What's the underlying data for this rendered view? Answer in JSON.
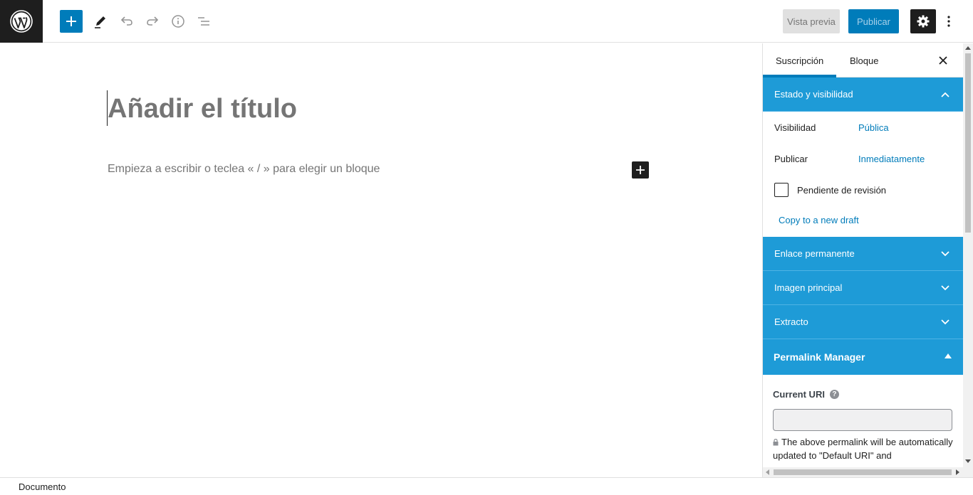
{
  "toolbar": {
    "logo_icon": "wordpress-icon",
    "add_block_icon": "plus-icon",
    "tools_icon": "pencil-icon",
    "undo_icon": "undo-icon",
    "redo_icon": "redo-icon",
    "details_icon": "info-icon",
    "outline_icon": "list-view-icon",
    "preview_label": "Vista previa",
    "publish_label": "Publicar",
    "settings_icon": "gear-icon",
    "more_icon": "more-vertical-icon"
  },
  "editor": {
    "title_placeholder": "Añadir el título",
    "block_placeholder": "Empieza a escribir o teclea « / » para elegir un bloque",
    "inline_add_icon": "plus-icon"
  },
  "sidebar": {
    "tabs": [
      {
        "label": "Suscripción",
        "active": true
      },
      {
        "label": "Bloque",
        "active": false
      }
    ],
    "status_panel": {
      "title": "Estado y visibilidad",
      "expanded": true,
      "visibility_label": "Visibilidad",
      "visibility_value": "Pública",
      "publish_label": "Publicar",
      "publish_value": "Inmediatamente",
      "pending_review_label": "Pendiente de revisión",
      "pending_review_checked": false,
      "copy_link": "Copy to a new draft"
    },
    "collapsed_panels": [
      {
        "title": "Enlace permanente"
      },
      {
        "title": "Imagen principal"
      },
      {
        "title": "Extracto"
      }
    ],
    "permalink_manager": {
      "title": "Permalink Manager",
      "current_uri_label": "Current URI",
      "help_glyph": "?",
      "current_uri_value": "",
      "note": "The above permalink will be automatically updated to \"Default URI\" and"
    }
  },
  "footer": {
    "breadcrumb": "Documento"
  },
  "colors": {
    "accent": "#007cba",
    "panel_header": "#1e9bd7",
    "dark": "#1e1e1e"
  }
}
